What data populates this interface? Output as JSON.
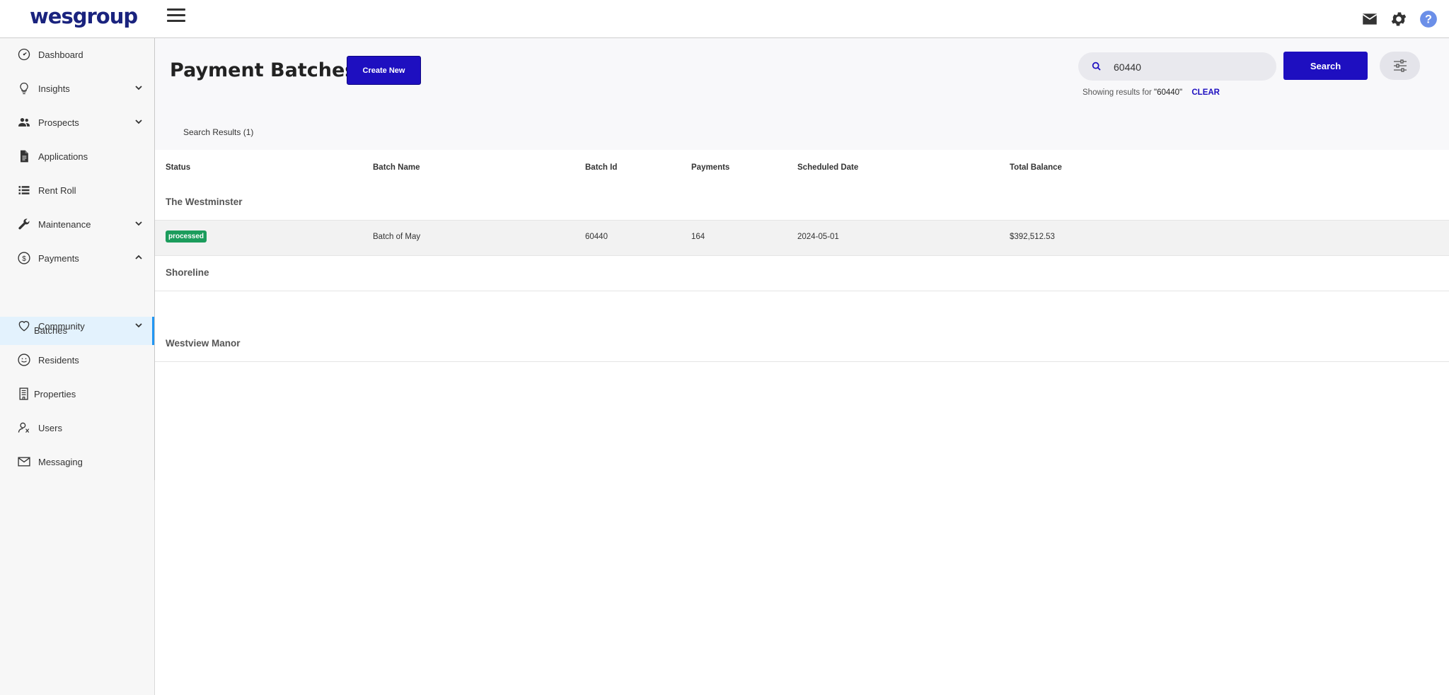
{
  "app": {
    "logo": "wesgroup"
  },
  "sidebar": {
    "items": [
      {
        "label": "Dashboard",
        "icon": "dashboard-gauge-icon"
      },
      {
        "label": "Insights",
        "icon": "lightbulb-icon",
        "expandable": true
      },
      {
        "label": "Prospects",
        "icon": "people-icon",
        "expandable": true
      },
      {
        "label": "Applications",
        "icon": "document-icon"
      },
      {
        "label": "Rent Roll",
        "icon": "list-icon"
      },
      {
        "label": "Maintenance",
        "icon": "wrench-icon",
        "expandable": true
      },
      {
        "label": "Payments",
        "icon": "dollar-circle-icon",
        "expanded": true
      },
      {
        "label": "Community",
        "icon": "heart-icon",
        "expandable": true
      },
      {
        "label": "Residents",
        "icon": "smiley-icon"
      },
      {
        "label": "Properties",
        "icon": "building-icon"
      },
      {
        "label": "Users",
        "icon": "user-icon"
      },
      {
        "label": "Messaging",
        "icon": "envelope-icon"
      }
    ],
    "sub_item": {
      "label": "Batches",
      "active": true
    }
  },
  "header": {
    "icons": [
      "mail-icon",
      "gear-icon",
      "help-icon"
    ]
  },
  "page": {
    "title": "Payment Batches.",
    "create_label": "Create New"
  },
  "search": {
    "value": "60440",
    "button_label": "Search",
    "results_prefix": "Showing results for",
    "results_query": "\"60440\"",
    "clear_label": "CLEAR"
  },
  "tabs": {
    "results_label": "Search Results (1)"
  },
  "table": {
    "columns": [
      "Status",
      "Batch Name",
      "Batch Id",
      "Payments",
      "Scheduled Date",
      "Total Balance"
    ],
    "groups": [
      {
        "name": "The Westminster",
        "rows": [
          {
            "status": "processed",
            "batch_name": "Batch of May",
            "batch_id": "60440",
            "payments": "164",
            "scheduled_date": "2024-05-01",
            "total_balance": "$392,512.53"
          }
        ]
      },
      {
        "name": "Shoreline",
        "rows": []
      },
      {
        "name": "Westview Manor",
        "rows": []
      }
    ]
  },
  "colors": {
    "primary": "#1e0fc0",
    "badge_green": "#1b9c5c",
    "logo": "#1a237e",
    "active_accent": "#2196f3"
  }
}
